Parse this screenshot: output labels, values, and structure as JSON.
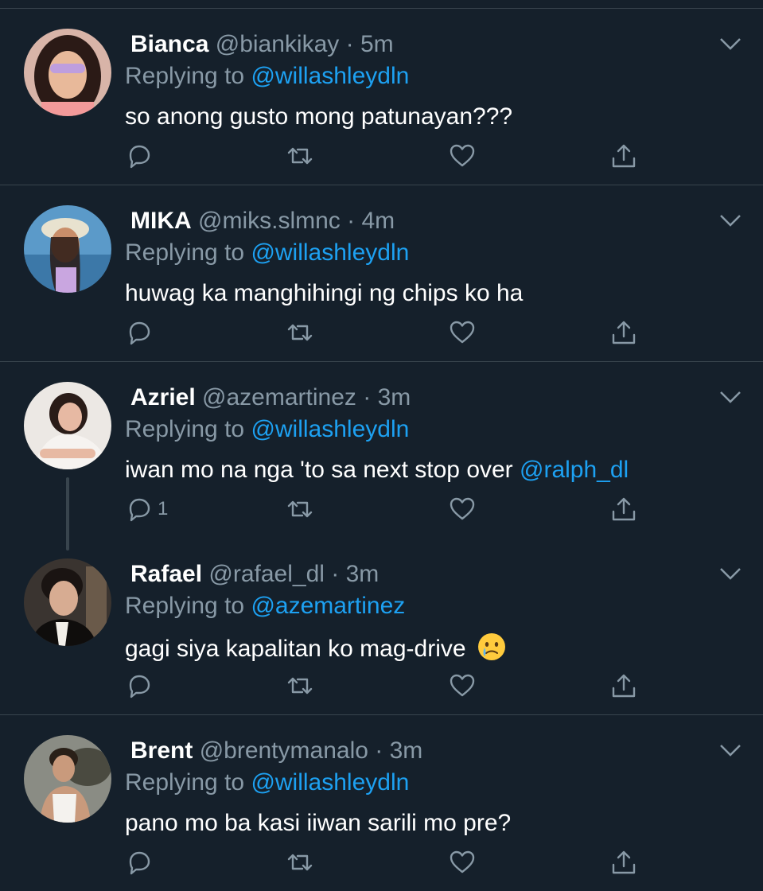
{
  "tweets": [
    {
      "name": "Bianca",
      "handle": "@biankikay",
      "time": "5m",
      "replying_prefix": "Replying to ",
      "replying_to": "@willashleydln",
      "text": "so anong gusto mong patunayan???",
      "text_mention": "",
      "reply_count": ""
    },
    {
      "name": "MIKA",
      "handle": "@miks.slmnc",
      "time": "4m",
      "replying_prefix": "Replying to ",
      "replying_to": "@willashleydln",
      "text": "huwag ka manghihingi ng chips ko ha",
      "text_mention": "",
      "reply_count": ""
    },
    {
      "name": "Azriel",
      "handle": "@azemartinez",
      "time": "3m",
      "replying_prefix": "Replying to ",
      "replying_to": "@willashleydln",
      "text": "iwan mo na nga 'to sa next stop over ",
      "text_mention": "@ralph_dl",
      "reply_count": "1"
    },
    {
      "name": "Rafael",
      "handle": "@rafael_dl",
      "time": "3m",
      "replying_prefix": "Replying to ",
      "replying_to": "@azemartinez",
      "text": "gagi siya kapalitan ko mag-drive",
      "text_mention": "",
      "reply_count": "",
      "emoji": "crying-face"
    },
    {
      "name": "Brent",
      "handle": "@brentymanalo",
      "time": "3m",
      "replying_prefix": "Replying to ",
      "replying_to": "@willashleydln",
      "text": "pano mo ba kasi iiwan sarili mo pre?",
      "text_mention": "",
      "reply_count": ""
    }
  ],
  "separator": "·",
  "icons": {
    "reply": "reply-icon",
    "retweet": "retweet-icon",
    "like": "heart-icon",
    "share": "share-icon",
    "menu": "chevron-down-icon"
  },
  "colors": {
    "background": "#15202b",
    "divider": "#38444d",
    "secondary_text": "#8899a6",
    "mention": "#1da1f2",
    "primary_text": "#ffffff"
  }
}
